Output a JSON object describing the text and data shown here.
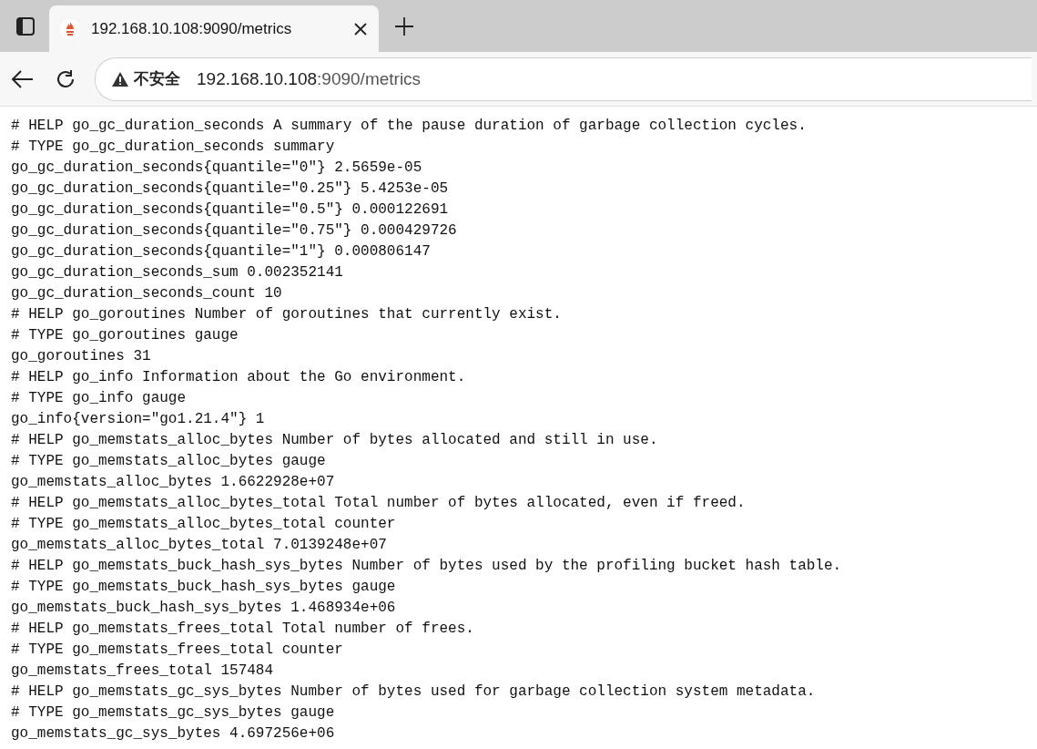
{
  "tab": {
    "title": "192.168.10.108:9090/metrics",
    "selected": true
  },
  "toolbar": {
    "security_label": "不安全",
    "url_host": "192.168.10.108",
    "url_rest": ":9090/metrics"
  },
  "lines": [
    "# HELP go_gc_duration_seconds A summary of the pause duration of garbage collection cycles.",
    "# TYPE go_gc_duration_seconds summary",
    "go_gc_duration_seconds{quantile=\"0\"} 2.5659e-05",
    "go_gc_duration_seconds{quantile=\"0.25\"} 5.4253e-05",
    "go_gc_duration_seconds{quantile=\"0.5\"} 0.000122691",
    "go_gc_duration_seconds{quantile=\"0.75\"} 0.000429726",
    "go_gc_duration_seconds{quantile=\"1\"} 0.000806147",
    "go_gc_duration_seconds_sum 0.002352141",
    "go_gc_duration_seconds_count 10",
    "# HELP go_goroutines Number of goroutines that currently exist.",
    "# TYPE go_goroutines gauge",
    "go_goroutines 31",
    "# HELP go_info Information about the Go environment.",
    "# TYPE go_info gauge",
    "go_info{version=\"go1.21.4\"} 1",
    "# HELP go_memstats_alloc_bytes Number of bytes allocated and still in use.",
    "# TYPE go_memstats_alloc_bytes gauge",
    "go_memstats_alloc_bytes 1.6622928e+07",
    "# HELP go_memstats_alloc_bytes_total Total number of bytes allocated, even if freed.",
    "# TYPE go_memstats_alloc_bytes_total counter",
    "go_memstats_alloc_bytes_total 7.0139248e+07",
    "# HELP go_memstats_buck_hash_sys_bytes Number of bytes used by the profiling bucket hash table.",
    "# TYPE go_memstats_buck_hash_sys_bytes gauge",
    "go_memstats_buck_hash_sys_bytes 1.468934e+06",
    "# HELP go_memstats_frees_total Total number of frees.",
    "# TYPE go_memstats_frees_total counter",
    "go_memstats_frees_total 157484",
    "# HELP go_memstats_gc_sys_bytes Number of bytes used for garbage collection system metadata.",
    "# TYPE go_memstats_gc_sys_bytes gauge",
    "go_memstats_gc_sys_bytes 4.697256e+06"
  ]
}
